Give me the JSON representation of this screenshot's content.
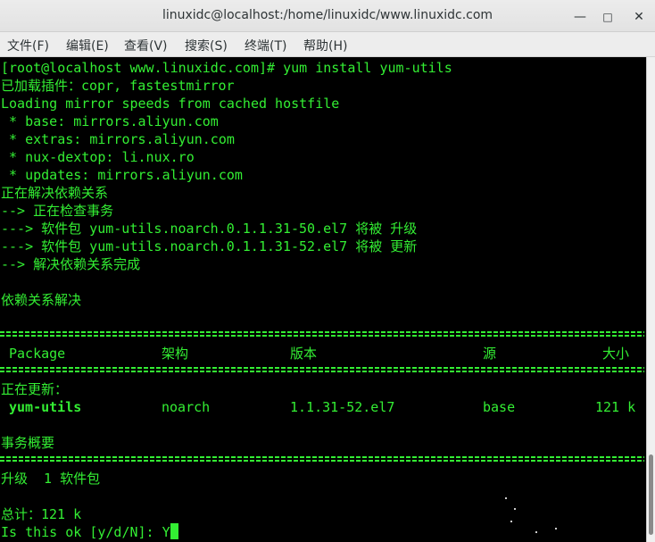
{
  "window": {
    "title": "linuxidc@localhost:/home/linuxidc/www.linuxidc.com",
    "minimize_glyph": "—",
    "maximize_glyph": "□",
    "close_glyph": "✕"
  },
  "menu": [
    "文件(F)",
    "编辑(E)",
    "查看(V)",
    "搜索(S)",
    "终端(T)",
    "帮助(H)"
  ],
  "terminal": {
    "lines": [
      "[root@localhost www.linuxidc.com]# yum install yum-utils",
      "已加载插件：copr, fastestmirror",
      "Loading mirror speeds from cached hostfile",
      " * base: mirrors.aliyun.com",
      " * extras: mirrors.aliyun.com",
      " * nux-dextop: li.nux.ro",
      " * updates: mirrors.aliyun.com",
      "正在解决依赖关系",
      "--> 正在检查事务",
      "---> 软件包 yum-utils.noarch.0.1.1.31-50.el7 将被 升级",
      "---> 软件包 yum-utils.noarch.0.1.1.31-52.el7 将被 更新",
      "--> 解决依赖关系完成",
      "依赖关系解决"
    ],
    "table": {
      "headers": [
        "Package",
        "架构",
        "版本",
        "源",
        "大小"
      ],
      "section_label": "正在更新：",
      "rows": [
        {
          "package": "yum-utils",
          "arch": "noarch",
          "version": "1.1.31-52.el7",
          "repo": "base",
          "size": "121 k"
        }
      ]
    },
    "summary_title": "事务概要",
    "upgrade_line": "升级  1 软件包",
    "total_line": "总计：121 k",
    "prompt": "Is this ok [y/d/N]: Y"
  },
  "colors": {
    "terminal_fg": "#33ee33",
    "terminal_bg": "#000000",
    "titlebar_bg": "#e8e8e8"
  }
}
